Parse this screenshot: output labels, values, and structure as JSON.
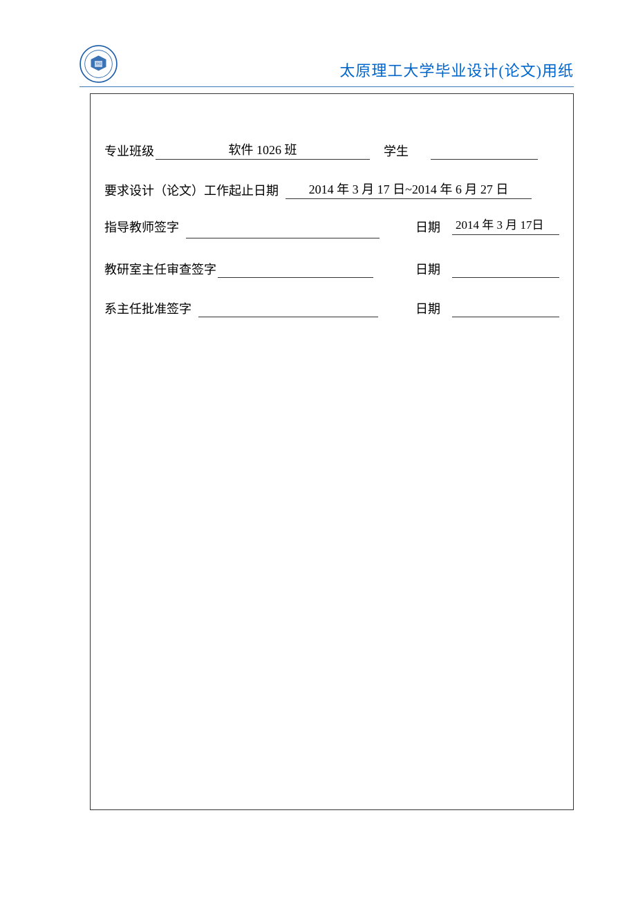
{
  "header": {
    "title": "太原理工大学毕业设计(论文)用纸",
    "logo_year": "1902"
  },
  "form": {
    "row1": {
      "label_major": "专业班级",
      "value_major": "软件 1026 班",
      "label_student": "学生",
      "value_student": ""
    },
    "row2": {
      "label_dates": "要求设计（论文）工作起止日期",
      "value_dates": "2014 年 3 月 17 日~2014 年 6 月 27 日"
    },
    "row3": {
      "label_advisor": "指导教师签字",
      "value_advisor": "",
      "label_date": "日期",
      "value_date": "2014 年 3 月 17日"
    },
    "row4": {
      "label_head": "教研室主任审查签字",
      "value_head": "",
      "label_date": "日期",
      "value_date": ""
    },
    "row5": {
      "label_dean": "系主任批准签字",
      "value_dean": "",
      "label_date": "日期",
      "value_date": ""
    }
  }
}
